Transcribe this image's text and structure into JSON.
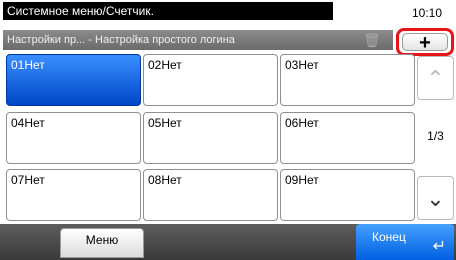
{
  "header": {
    "title": "Системное меню/Счетчик.",
    "time": "10:10",
    "breadcrumb": "Настройки пр... - Настройка простого логина",
    "add_label": "+"
  },
  "grid": {
    "cells": [
      {
        "id": "01",
        "text": "Нет"
      },
      {
        "id": "02",
        "text": "Нет"
      },
      {
        "id": "03",
        "text": "Нет"
      },
      {
        "id": "04",
        "text": "Нет"
      },
      {
        "id": "05",
        "text": "Нет"
      },
      {
        "id": "06",
        "text": "Нет"
      },
      {
        "id": "07",
        "text": "Нет"
      },
      {
        "id": "08",
        "text": "Нет"
      },
      {
        "id": "09",
        "text": "Нет"
      }
    ],
    "selected_index": 0
  },
  "pager": {
    "page": "1/3"
  },
  "footer": {
    "menu_label": "Меню",
    "end_label": "Конец"
  },
  "icons": {
    "trash": "trash-icon",
    "up": "chevron-up-icon",
    "down": "chevron-down-icon",
    "enter": "enter-icon"
  },
  "colors": {
    "selected": "#0055e0",
    "highlight_border": "#e8141a"
  }
}
